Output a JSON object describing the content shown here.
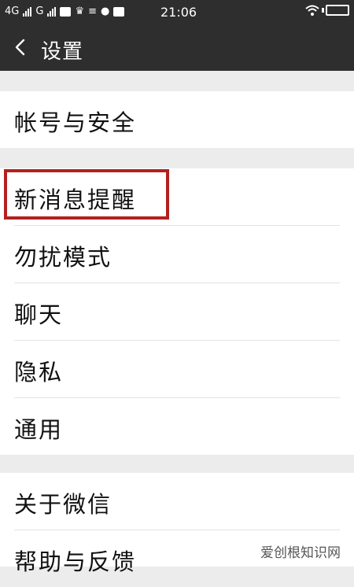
{
  "status_bar": {
    "network1": "4G",
    "network2": "G",
    "time": "21:06"
  },
  "title_bar": {
    "title": "设置",
    "back_icon": "chevron-left-icon"
  },
  "menu": {
    "group1": [
      {
        "label": "帐号与安全"
      }
    ],
    "group2": [
      {
        "label": "新消息提醒",
        "highlighted": true
      },
      {
        "label": "勿扰模式"
      },
      {
        "label": "聊天"
      },
      {
        "label": "隐私"
      },
      {
        "label": "通用"
      }
    ],
    "group3": [
      {
        "label": "关于微信"
      },
      {
        "label": "帮助与反馈"
      }
    ]
  },
  "highlight_color": "#b3201f",
  "watermark": "爱创根知识网"
}
